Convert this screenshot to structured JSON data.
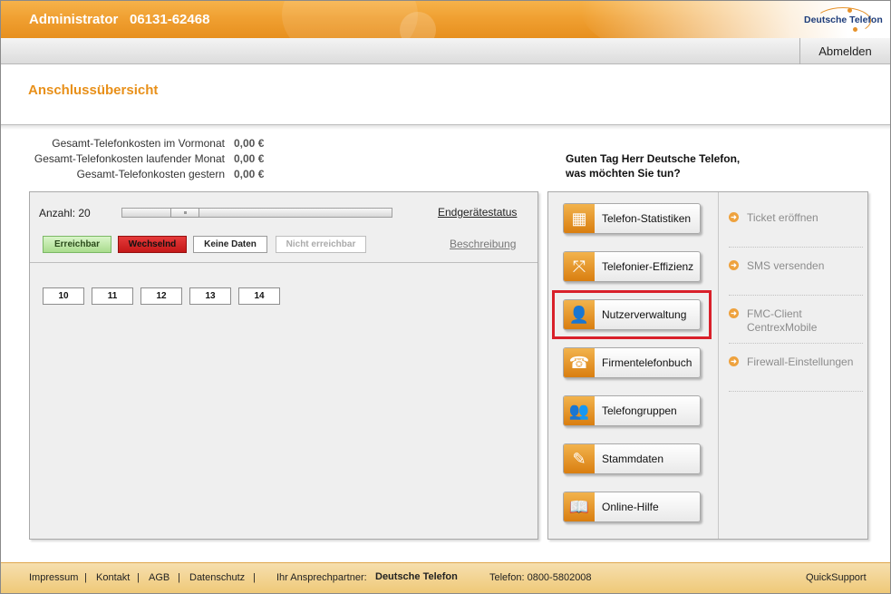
{
  "header": {
    "role": "Administrator",
    "phone": "06131-62468",
    "logo_text": "Deutsche Telefon"
  },
  "subbar": {
    "logout_label": "Abmelden"
  },
  "page": {
    "title": "Anschlussübersicht"
  },
  "costs": [
    {
      "label": "Gesamt-Telefonkosten im Vormonat",
      "value": "0,00 €"
    },
    {
      "label": "Gesamt-Telefonkosten laufender Monat",
      "value": "0,00 €"
    },
    {
      "label": "Gesamt-Telefonkosten gestern",
      "value": "0,00 €"
    }
  ],
  "greeting": {
    "line1": "Guten Tag Herr Deutsche Telefon,",
    "line2": "was möchten Sie tun?"
  },
  "devices": {
    "count_label": "Anzahl: 20",
    "slider_fraction": 0.2,
    "status_link": "Endgerätestatus",
    "description_link": "Beschreibung",
    "legend": {
      "reachable": "Erreichbar",
      "changing": "Wechselnd",
      "no_data": "Keine Daten",
      "unreachable": "Nicht erreichbar"
    },
    "slots": [
      "10",
      "11",
      "12",
      "13",
      "14"
    ]
  },
  "actions": [
    {
      "label": "Telefon-Statistiken",
      "icon": "statistics-icon",
      "glyph": "▦"
    },
    {
      "label": "Telefonier-Effizienz",
      "icon": "efficiency-icon",
      "glyph": "⤧"
    },
    {
      "label": "Nutzerverwaltung",
      "icon": "user-icon",
      "glyph": "👤"
    },
    {
      "label": "Firmentelefonbuch",
      "icon": "phonebook-icon",
      "glyph": "☎"
    },
    {
      "label": "Telefongruppen",
      "icon": "group-icon",
      "glyph": "👥"
    },
    {
      "label": "Stammdaten",
      "icon": "masterdata-icon",
      "glyph": "✎"
    },
    {
      "label": "Online-Hilfe",
      "icon": "help-book-icon",
      "glyph": "📖"
    }
  ],
  "side_links": [
    {
      "label": "Ticket eröffnen"
    },
    {
      "label": "SMS versenden"
    },
    {
      "label": "FMC-Client\nCentrexMobile"
    },
    {
      "label": "Firewall-Einstellungen"
    }
  ],
  "footer": {
    "impressum": "Impressum",
    "kontakt": "Kontakt",
    "agb": "AGB",
    "datenschutz": "Datenschutz",
    "separator": "|",
    "partner_label": "Ihr Ansprechpartner:",
    "partner_name": "Deutsche Telefon",
    "phone": "Telefon: 0800-5802008",
    "quicksupport": "QuickSupport"
  },
  "colors": {
    "accent": "#f0a032",
    "title": "#e8901a",
    "highlight": "#d9202a",
    "reachable": "#a9dc8d",
    "changing": "#d42020"
  }
}
